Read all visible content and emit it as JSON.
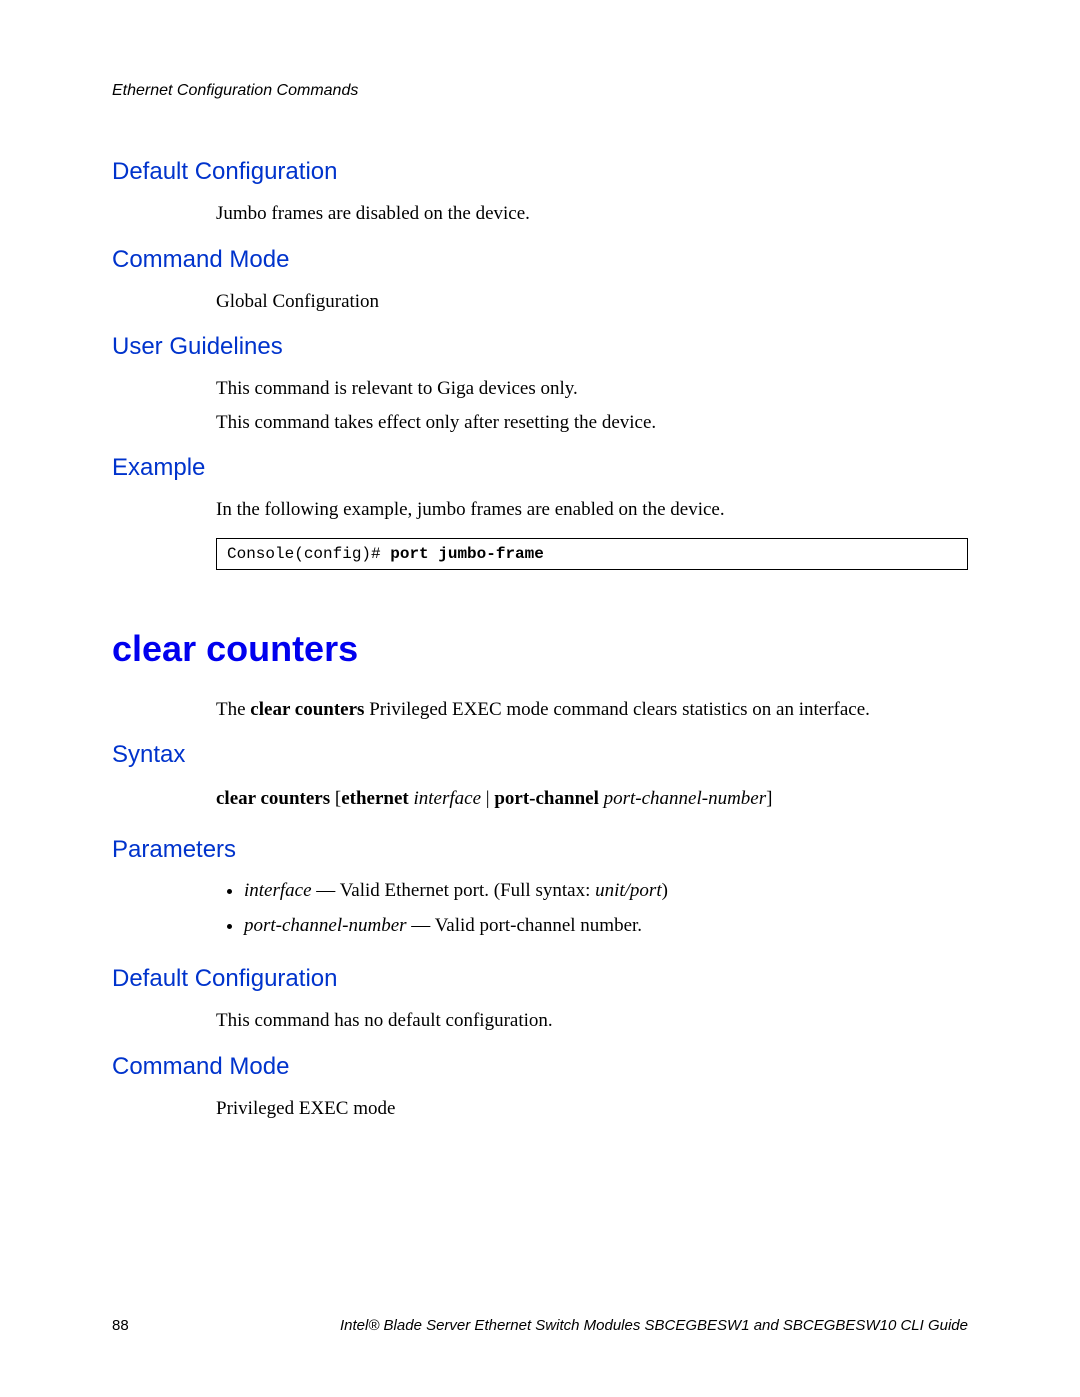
{
  "header": {
    "chapter": "Ethernet Configuration Commands"
  },
  "sections": {
    "default_config_1": {
      "heading": "Default Configuration",
      "body": "Jumbo frames are disabled on the device."
    },
    "command_mode_1": {
      "heading": "Command Mode",
      "body": "Global Configuration"
    },
    "user_guidelines": {
      "heading": "User Guidelines",
      "body1": "This command is relevant to Giga devices only.",
      "body2": "This command takes effect only after resetting the device."
    },
    "example": {
      "heading": "Example",
      "body": "In the following example, jumbo frames are enabled on the device.",
      "code_prompt": "Console(config)# ",
      "code_cmd": "port jumbo-frame"
    },
    "command": {
      "title": "clear counters",
      "intro_pre": "The ",
      "intro_bold": "clear counters",
      "intro_post": " Privileged EXEC mode command clears statistics on an interface."
    },
    "syntax": {
      "heading": "Syntax",
      "p1_b1": "clear counters ",
      "p1_t1": "[",
      "p1_b2": "ethernet ",
      "p1_i1": "interface",
      "p1_t2": " | ",
      "p1_b3": "port-channel ",
      "p1_i2": "port-channel-number",
      "p1_t3": "]"
    },
    "parameters": {
      "heading": "Parameters",
      "item1_i": "interface",
      "item1_t": " — Valid Ethernet port. (Full syntax: ",
      "item1_i2": "unit/port",
      "item1_t2": ")",
      "item2_i": "port-channel-number",
      "item2_t": " — Valid port-channel number."
    },
    "default_config_2": {
      "heading": "Default Configuration",
      "body": "This command has no default configuration."
    },
    "command_mode_2": {
      "heading": "Command Mode",
      "body": "Privileged EXEC mode"
    }
  },
  "footer": {
    "page": "88",
    "title": "Intel® Blade Server Ethernet Switch Modules SBCEGBESW1 and SBCEGBESW10 CLI Guide"
  }
}
